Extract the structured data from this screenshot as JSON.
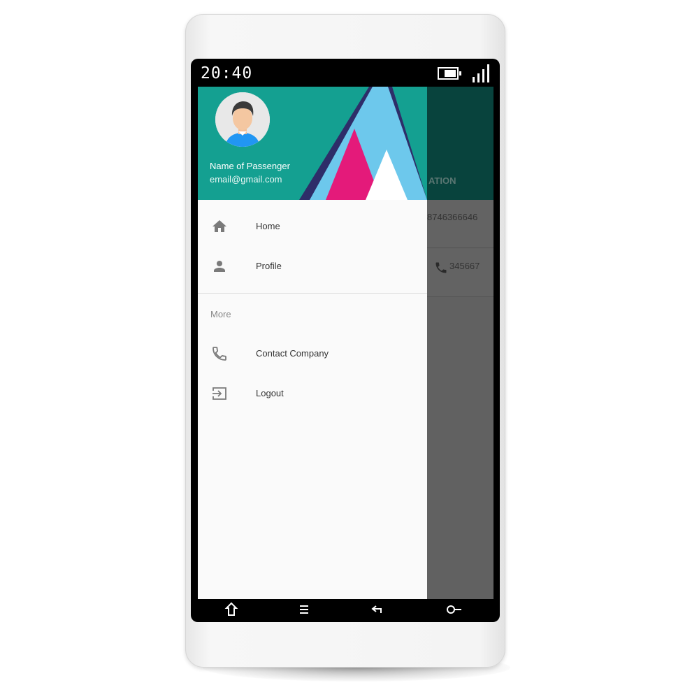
{
  "status_bar": {
    "time": "20:40"
  },
  "drawer": {
    "header": {
      "user_name": "Name of Passenger",
      "user_email": "email@gmail.com",
      "accent_colors": [
        "#14a091",
        "#2e2d69",
        "#6dc8ec",
        "#e41a7a"
      ]
    },
    "items": [
      {
        "label": "Home",
        "icon": "home-icon"
      },
      {
        "label": "Profile",
        "icon": "person-icon"
      }
    ],
    "section_label": "More",
    "more_items": [
      {
        "label": "Contact Company",
        "icon": "phone-icon"
      },
      {
        "label": "Logout",
        "icon": "logout-icon"
      }
    ]
  },
  "background": {
    "header_partial": "ATION",
    "rows": [
      {
        "text": "8746366646"
      },
      {
        "text": "345667",
        "icon": "phone-icon"
      }
    ]
  },
  "navigation_bar": {
    "buttons": [
      "home-nav-icon",
      "menu-nav-icon",
      "back-nav-icon",
      "key-nav-icon"
    ]
  }
}
